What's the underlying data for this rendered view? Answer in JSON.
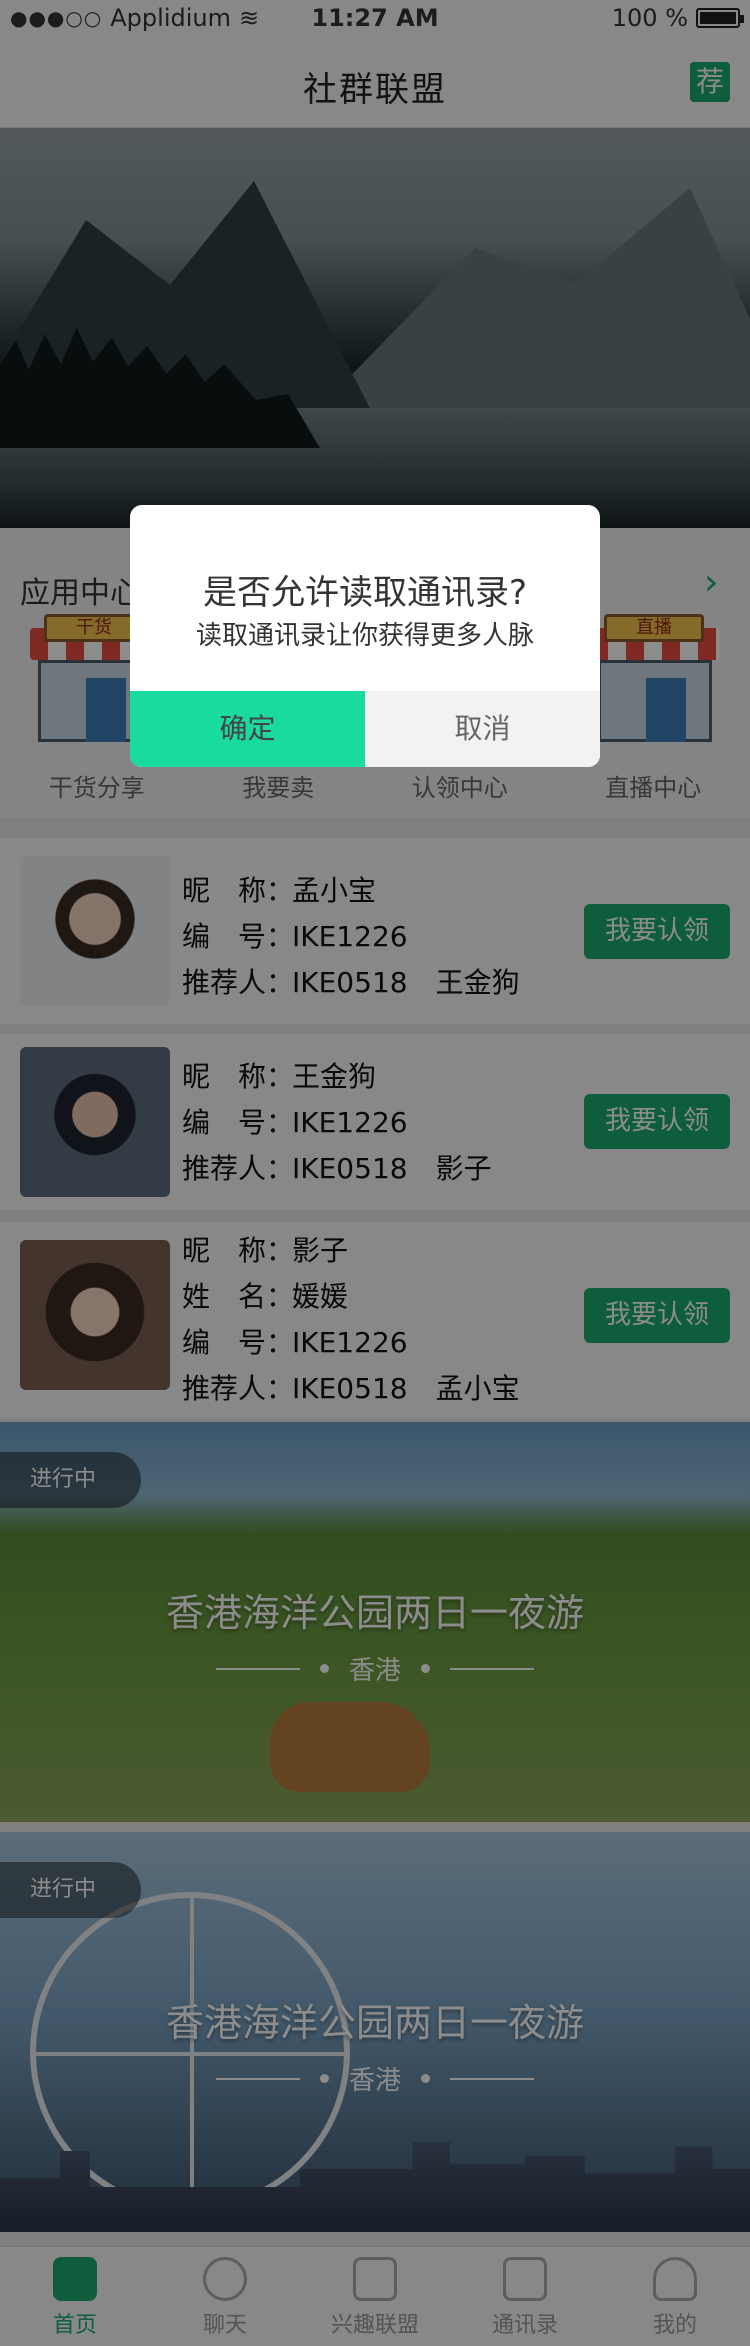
{
  "status": {
    "carrier": "Applidium",
    "time": "11:27 AM",
    "battery": "100 %",
    "battery_level": 1.0
  },
  "header": {
    "title": "社群联盟",
    "recommend_label": "荐"
  },
  "appcenter": {
    "label": "应用中心",
    "shops": [
      {
        "sign": "干货",
        "label": "干货分享"
      },
      {
        "sign": "",
        "label": "我要卖"
      },
      {
        "sign": "",
        "label": "认领中心"
      },
      {
        "sign": "直播",
        "label": "直播中心"
      }
    ]
  },
  "members": [
    {
      "rows": [
        [
          "昵　称：",
          "孟小宝"
        ],
        [
          "编　号：",
          "IKE1226"
        ],
        [
          "推荐人：",
          "IKE0518　王金狗"
        ]
      ],
      "button": "我要认领"
    },
    {
      "rows": [
        [
          "昵　称：",
          "王金狗"
        ],
        [
          "编　号：",
          "IKE1226"
        ],
        [
          "推荐人：",
          "IKE0518　影子"
        ]
      ],
      "button": "我要认领"
    },
    {
      "rows": [
        [
          "昵　称：",
          "影子"
        ],
        [
          "姓　名：",
          "媛媛"
        ],
        [
          "编　号：",
          "IKE1226"
        ],
        [
          "推荐人：",
          "IKE0518　孟小宝"
        ]
      ],
      "button": "我要认领"
    }
  ],
  "activities": [
    {
      "badge": "进行中",
      "title": "香港海洋公园两日一夜游",
      "location": "香港"
    },
    {
      "badge": "进行中",
      "title": "香港海洋公园两日一夜游",
      "location": "香港"
    }
  ],
  "tabs": [
    {
      "label": "首页",
      "icon": "home-icon",
      "active": true
    },
    {
      "label": "聊天",
      "icon": "chat-icon",
      "active": false
    },
    {
      "label": "兴趣联盟",
      "icon": "interest-icon",
      "active": false
    },
    {
      "label": "通讯录",
      "icon": "contacts-icon",
      "active": false
    },
    {
      "label": "我的",
      "icon": "profile-icon",
      "active": false
    }
  ],
  "modal": {
    "question": "是否允许读取通讯录?",
    "subtitle": "读取通讯录让你获得更多人脉",
    "ok": "确定",
    "cancel": "取消"
  },
  "colors": {
    "accent": "#1aa96f",
    "modal_ok": "#1adb9f",
    "text": "#333333"
  }
}
